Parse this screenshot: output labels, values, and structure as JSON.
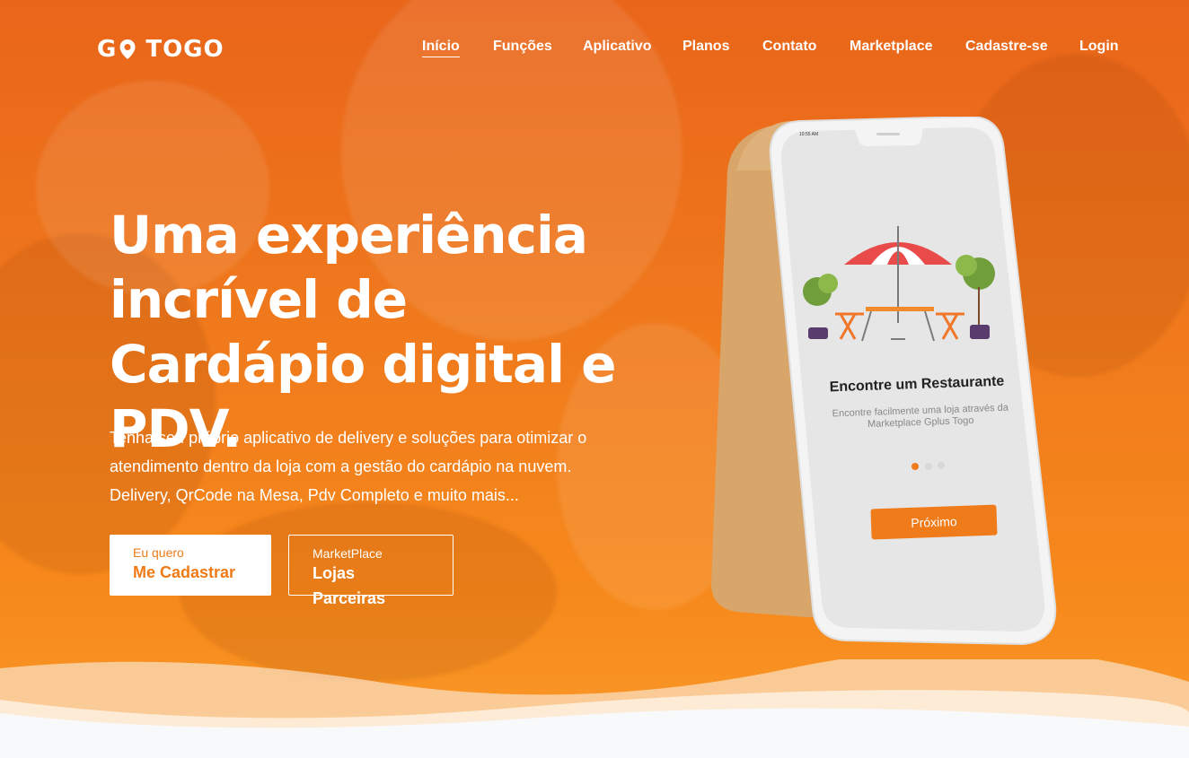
{
  "brand": {
    "logo_text_left": "G",
    "logo_text_right": "TOGO"
  },
  "nav": {
    "items": [
      {
        "label": "Início",
        "active": true
      },
      {
        "label": "Funções"
      },
      {
        "label": "Aplicativo"
      },
      {
        "label": "Planos"
      },
      {
        "label": "Contato"
      },
      {
        "label": "Marketplace"
      },
      {
        "label": "Cadastre-se"
      },
      {
        "label": "Login"
      }
    ]
  },
  "hero": {
    "title": "Uma experiência incrível de Cardápio digital e PDV.",
    "description": "Tenha seu próprio aplicativo de delivery e soluções para otimizar o atendimento dentro da loja com a gestão do cardápio na nuvem. Delivery, QrCode na Mesa, Pdv Completo e muito mais...",
    "primary_button": {
      "small": "Eu quero",
      "big": "Me Cadastrar"
    },
    "secondary_button": {
      "small": "MarketPlace",
      "big": "Lojas Parceiras"
    }
  },
  "phone": {
    "time": "10:55 AM",
    "title": "Encontre um Restaurante",
    "subtitle": "Encontre facilmente uma loja através da Marketplace Gplus Togo",
    "button": "Próximo",
    "pager": {
      "count": 3,
      "active_index": 0
    }
  },
  "colors": {
    "accent": "#f07b1a",
    "white": "#ffffff"
  }
}
